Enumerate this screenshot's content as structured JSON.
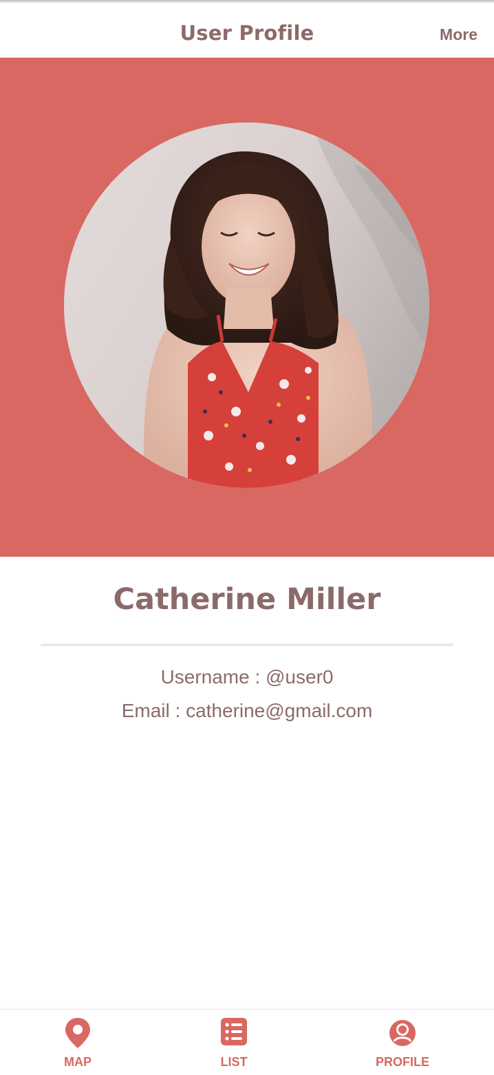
{
  "header": {
    "title": "User Profile",
    "more_label": "More"
  },
  "colors": {
    "accent": "#d96862",
    "text": "#8c6a6a",
    "background": "#ffffff"
  },
  "profile": {
    "name": "Catherine Miller",
    "username_line": "Username : @user0",
    "email_line": "Email : catherine@gmail.com",
    "photo": "profile-photo"
  },
  "tabbar": {
    "tabs": [
      {
        "label": "MAP",
        "icon": "map-pin-icon"
      },
      {
        "label": "LIST",
        "icon": "list-icon"
      },
      {
        "label": "PROFILE",
        "icon": "user-circle-icon"
      }
    ]
  }
}
